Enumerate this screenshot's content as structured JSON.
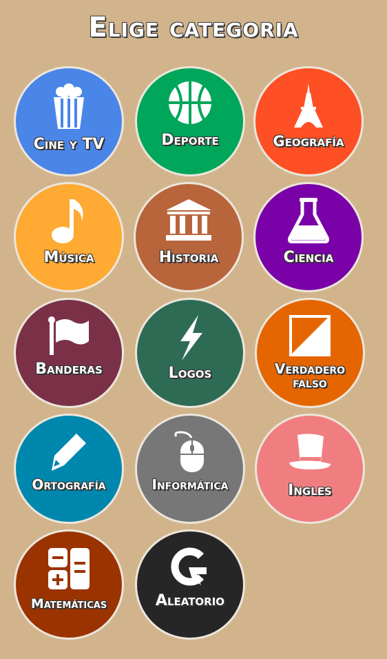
{
  "header": {
    "title": "Elige categoria"
  },
  "categories": [
    {
      "label": "Cine y TV",
      "color": "#4a86e8",
      "icon": "popcorn-icon"
    },
    {
      "label": "Deporte",
      "color": "#00a65a",
      "icon": "basketball-icon"
    },
    {
      "label": "Geografía",
      "color": "#ff4f24",
      "icon": "eiffel-tower-icon"
    },
    {
      "label": "Música",
      "color": "#ffaa33",
      "icon": "music-note-icon"
    },
    {
      "label": "Historia",
      "color": "#b8653c",
      "icon": "museum-icon"
    },
    {
      "label": "Ciencia",
      "color": "#7a00a8",
      "icon": "flask-icon"
    },
    {
      "label": "Banderas",
      "color": "#7a3147",
      "icon": "flag-icon"
    },
    {
      "label": "Logos",
      "color": "#2e6b55",
      "icon": "lightning-icon"
    },
    {
      "label": "Verdadero falso",
      "color": "#e56500",
      "icon": "true-false-icon"
    },
    {
      "label": "Ortografía",
      "color": "#0087ad",
      "icon": "pencil-icon"
    },
    {
      "label": "Informática",
      "color": "#777777",
      "icon": "mouse-icon"
    },
    {
      "label": "Ingles",
      "color": "#f07e80",
      "icon": "top-hat-icon"
    },
    {
      "label": "Matemáticas",
      "color": "#9a3300",
      "icon": "calculator-icon"
    },
    {
      "label": "Aleatorio",
      "color": "#262626",
      "icon": "shuffle-g-icon"
    }
  ]
}
